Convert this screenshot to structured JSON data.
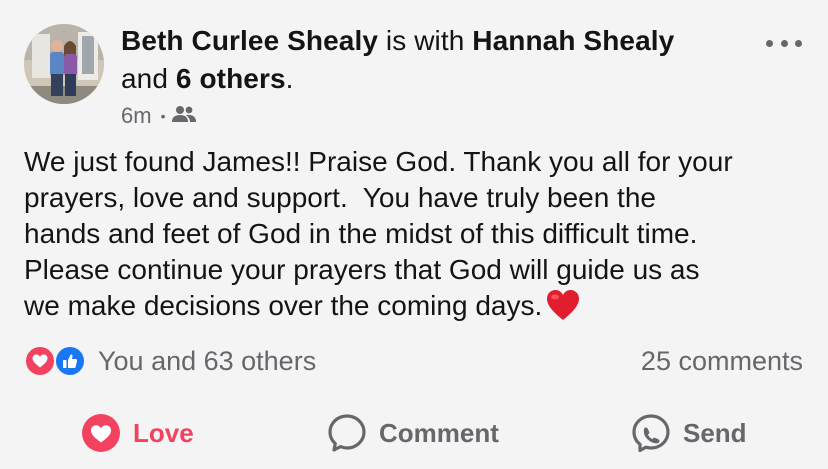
{
  "post": {
    "author": "Beth Curlee Shealy",
    "with_text": "is with",
    "tagged_person": "Hannah Shealy",
    "and_text": "and",
    "others_text": "6 others",
    "period": ".",
    "time": "6m",
    "audience_icon": "friends-icon",
    "more_icon": "more-options-icon",
    "body_lines": [
      "We just found James!! Praise God. Thank you all for your",
      "prayers, love and support.  You have truly been the",
      "hands and feet of God in the midst of this difficult time.",
      "Please continue your prayers that God will guide us as",
      "we make decisions over the coming days."
    ],
    "body_emoji": "red-heart-emoji"
  },
  "reactions": {
    "icons": [
      "love-reaction-icon",
      "like-reaction-icon"
    ],
    "summary": "You and 63 others",
    "comments": "25 comments"
  },
  "actions": {
    "love_label": "Love",
    "comment_label": "Comment",
    "send_label": "Send"
  },
  "colors": {
    "love": "#f3425f",
    "like": "#1877f2",
    "muted": "#65676b",
    "background": "#f4f4f5"
  }
}
